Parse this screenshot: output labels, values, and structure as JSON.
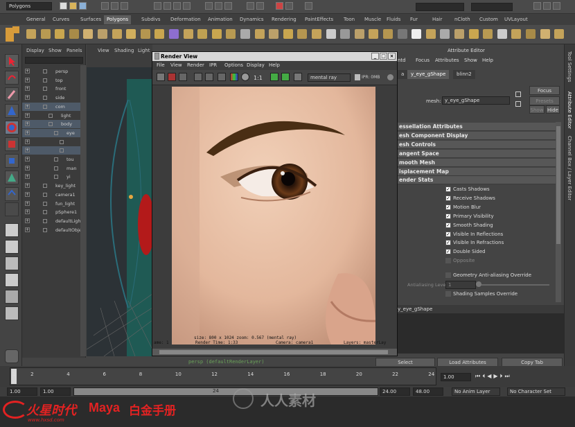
{
  "status_bar": {
    "mode": "Polygons"
  },
  "shelf_tabs": [
    "General",
    "Curves",
    "Surfaces",
    "Polygons",
    "Subdivs",
    "Deformation",
    "Animation",
    "Dynamics",
    "Rendering",
    "PaintEffects",
    "Toon",
    "Muscle",
    "Fluids",
    "Fur",
    "Hair",
    "nCloth",
    "Custom",
    "UVLayout"
  ],
  "shelf_active": "Polygons",
  "outliner": {
    "menu": [
      "Display",
      "Show",
      "Panels"
    ],
    "items": [
      {
        "label": "persp",
        "selected": false
      },
      {
        "label": "top",
        "selected": false
      },
      {
        "label": "front",
        "selected": false
      },
      {
        "label": "side",
        "selected": false
      },
      {
        "label": "com",
        "selected": true
      },
      {
        "label": "light",
        "selected": false
      },
      {
        "label": "body",
        "selected": true
      },
      {
        "label": "eye",
        "selected": true
      },
      {
        "label": "",
        "selected": false
      },
      {
        "label": "",
        "selected": true
      },
      {
        "label": "tou",
        "selected": false
      },
      {
        "label": "man",
        "selected": false
      },
      {
        "label": "yi",
        "selected": false
      },
      {
        "label": "key_light",
        "selected": false
      },
      {
        "label": "camera1",
        "selected": false
      },
      {
        "label": "fun_light",
        "selected": false
      },
      {
        "label": "pSphere1",
        "selected": false
      },
      {
        "label": "defaultLightS",
        "selected": false
      },
      {
        "label": "defaultObjed",
        "selected": false
      }
    ]
  },
  "viewport": {
    "menu": [
      "View",
      "Shading",
      "Light"
    ]
  },
  "render_view": {
    "title": "Render View",
    "menu": [
      "File",
      "View",
      "Render",
      "IPR",
      "Options",
      "Display",
      "Help"
    ],
    "renderer": "mental ray",
    "ipr_label": "IPR: 0MB",
    "ratio": "1:1",
    "info_line1": "size: 800 x 1024 zoom: 0.567      (mental ray)",
    "info_line2_prefix": "ame: 1",
    "info_render_time": "Render Time: 1:33",
    "info_camera": "Camera: camera1",
    "info_layers": "Layers: masterLay"
  },
  "render_layer_label": "persp (defaultRenderLayer)",
  "attribute_editor": {
    "header": "Attribute Editor",
    "menu": [
      "ntd",
      "Focus",
      "Attributes",
      "Show",
      "Help"
    ],
    "tabs": [
      "a",
      "y_eye_gShape",
      "blinn2"
    ],
    "active_tab": "y_eye_gShape",
    "mesh_label": "mesh:",
    "mesh_value": "y_eye_gShape",
    "focus": "Focus",
    "presets": "Presets",
    "show": "Show",
    "hide": "Hide",
    "sections": [
      "essellation Attributes",
      "esh Component Display",
      "esh Controls",
      "angent Space",
      "mooth Mesh",
      "isplacement Map",
      "ender Stats"
    ],
    "render_stats": [
      {
        "label": "Casts Shadows",
        "checked": true
      },
      {
        "label": "Receive Shadows",
        "checked": true
      },
      {
        "label": "Motion Blur",
        "checked": true
      },
      {
        "label": "Primary Visibility",
        "checked": true
      },
      {
        "label": "Smooth Shading",
        "checked": true
      },
      {
        "label": "Visible In Reflections",
        "checked": true
      },
      {
        "label": "Visible In Refractions",
        "checked": true
      },
      {
        "label": "Double Sided",
        "checked": true
      },
      {
        "label": "Opposite",
        "checked": false
      }
    ],
    "geom_aa": "Geometry Anti-aliasing Override",
    "aa_level_label": "Antialiasing Level",
    "aa_level_value": "1",
    "shading_samples": "Shading Samples Override",
    "node_label": "y_eye_gShape",
    "select": "Select",
    "load_attributes": "Load Attributes",
    "copy_tab": "Copy Tab"
  },
  "side_tabs": [
    "Tool Settings",
    "Attribute Editor",
    "Channel Box / Layer Editor"
  ],
  "time_slider": {
    "ticks": [
      "1",
      "2",
      "4",
      "6",
      "8",
      "10",
      "12",
      "14",
      "16",
      "18",
      "20",
      "22",
      "24"
    ],
    "current": "1.00"
  },
  "range": {
    "start": "1.00",
    "start2": "1.00",
    "mid": "24",
    "end": "24.00",
    "end2": "48.00",
    "anim_layer": "No Anim Layer",
    "char_set": "No Character Set"
  },
  "watermark": {
    "brand1": "火星时代",
    "brand2": "Maya",
    "brand3": "白金手册",
    "url": "www.hxsd.com",
    "center_text": "人人素材"
  },
  "colors": {
    "accent_selection": "#4e5a68",
    "logo_red": "#e32222"
  }
}
